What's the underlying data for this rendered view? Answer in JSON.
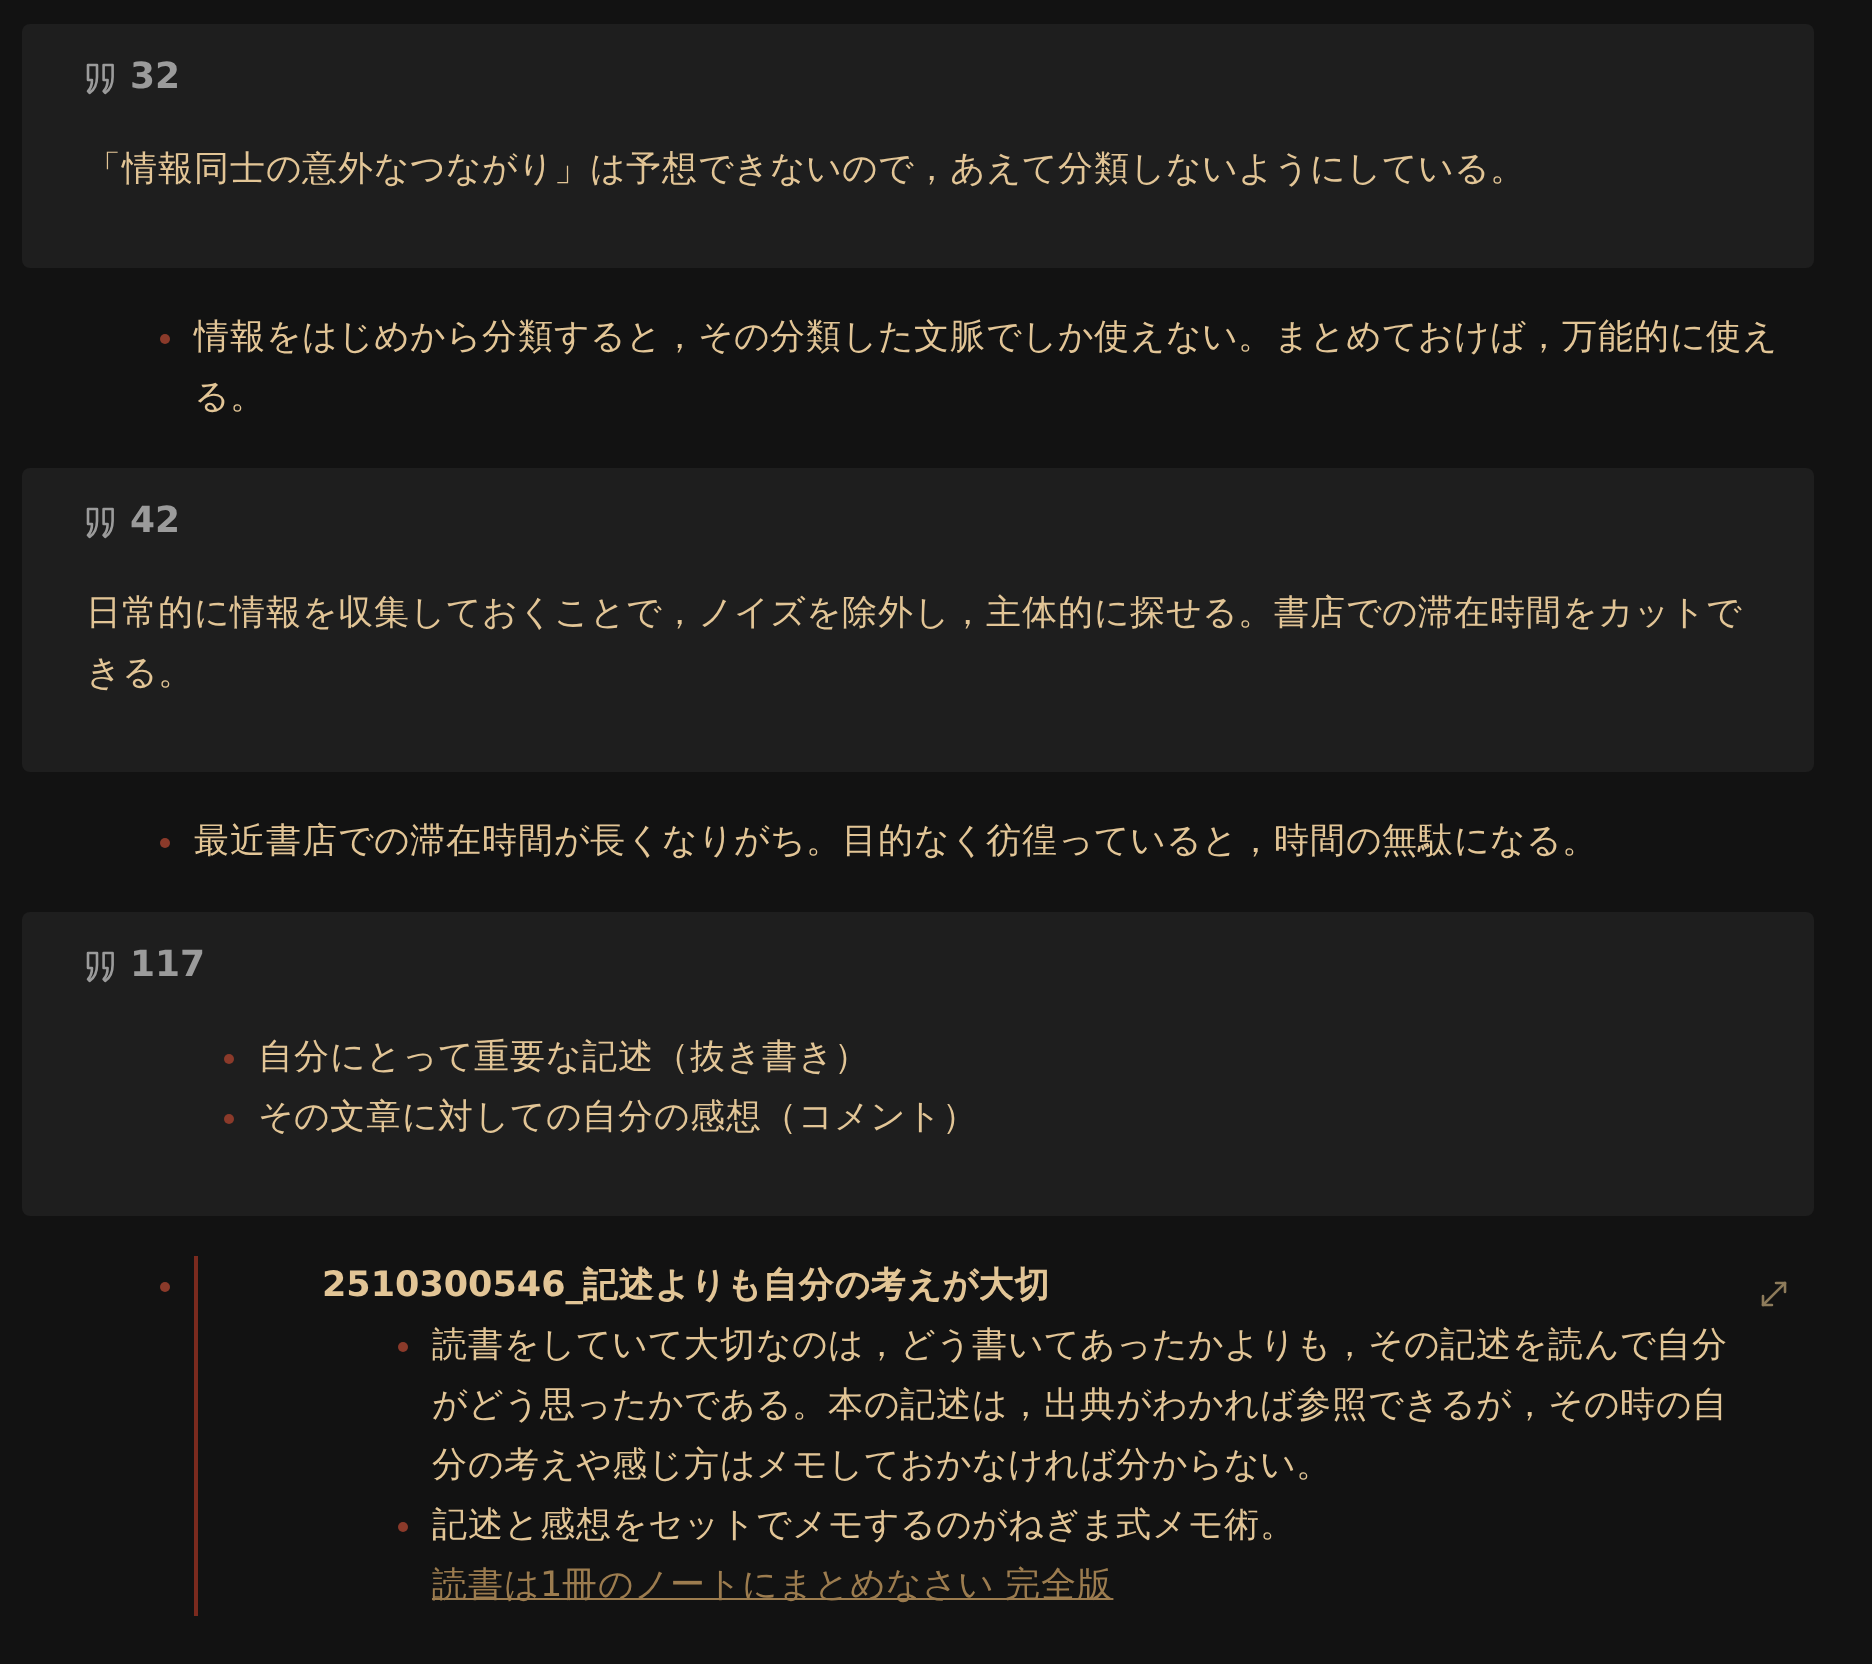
{
  "blocks": [
    {
      "kind": "callout",
      "page": "32",
      "text": "「情報同士の意外なつながり」は予想できないので，あえて分類しないようにしている。"
    },
    {
      "kind": "bullet",
      "text": "情報をはじめから分類すると，その分類した文脈でしか使えない。まとめておけば，万能的に使える。"
    },
    {
      "kind": "callout",
      "page": "42",
      "text": "日常的に情報を収集しておくことで，ノイズを除外し，主体的に探せる。書店での滞在時間をカットできる。"
    },
    {
      "kind": "bullet",
      "text": "最近書店での滞在時間が長くなりがち。目的なく彷徨っていると，時間の無駄になる。"
    },
    {
      "kind": "callout",
      "page": "117",
      "items": [
        "自分にとって重要な記述（抜き書き）",
        "その文章に対しての自分の感想（コメント）"
      ]
    },
    {
      "kind": "embed",
      "title": "2510300546_記述よりも自分の考えが大切",
      "items": [
        {
          "text": "読書をしていて大切なのは，どう書いてあったかよりも，その記述を読んで自分がどう思ったかである。本の記述は，出典がわかれば参照できるが，その時の自分の考えや感じ方はメモしておかなければ分からない。"
        },
        {
          "text": "記述と感想をセットでメモするのがねぎま式メモ術。",
          "link": "読書は1冊のノートにまとめなさい 完全版"
        }
      ]
    }
  ]
}
